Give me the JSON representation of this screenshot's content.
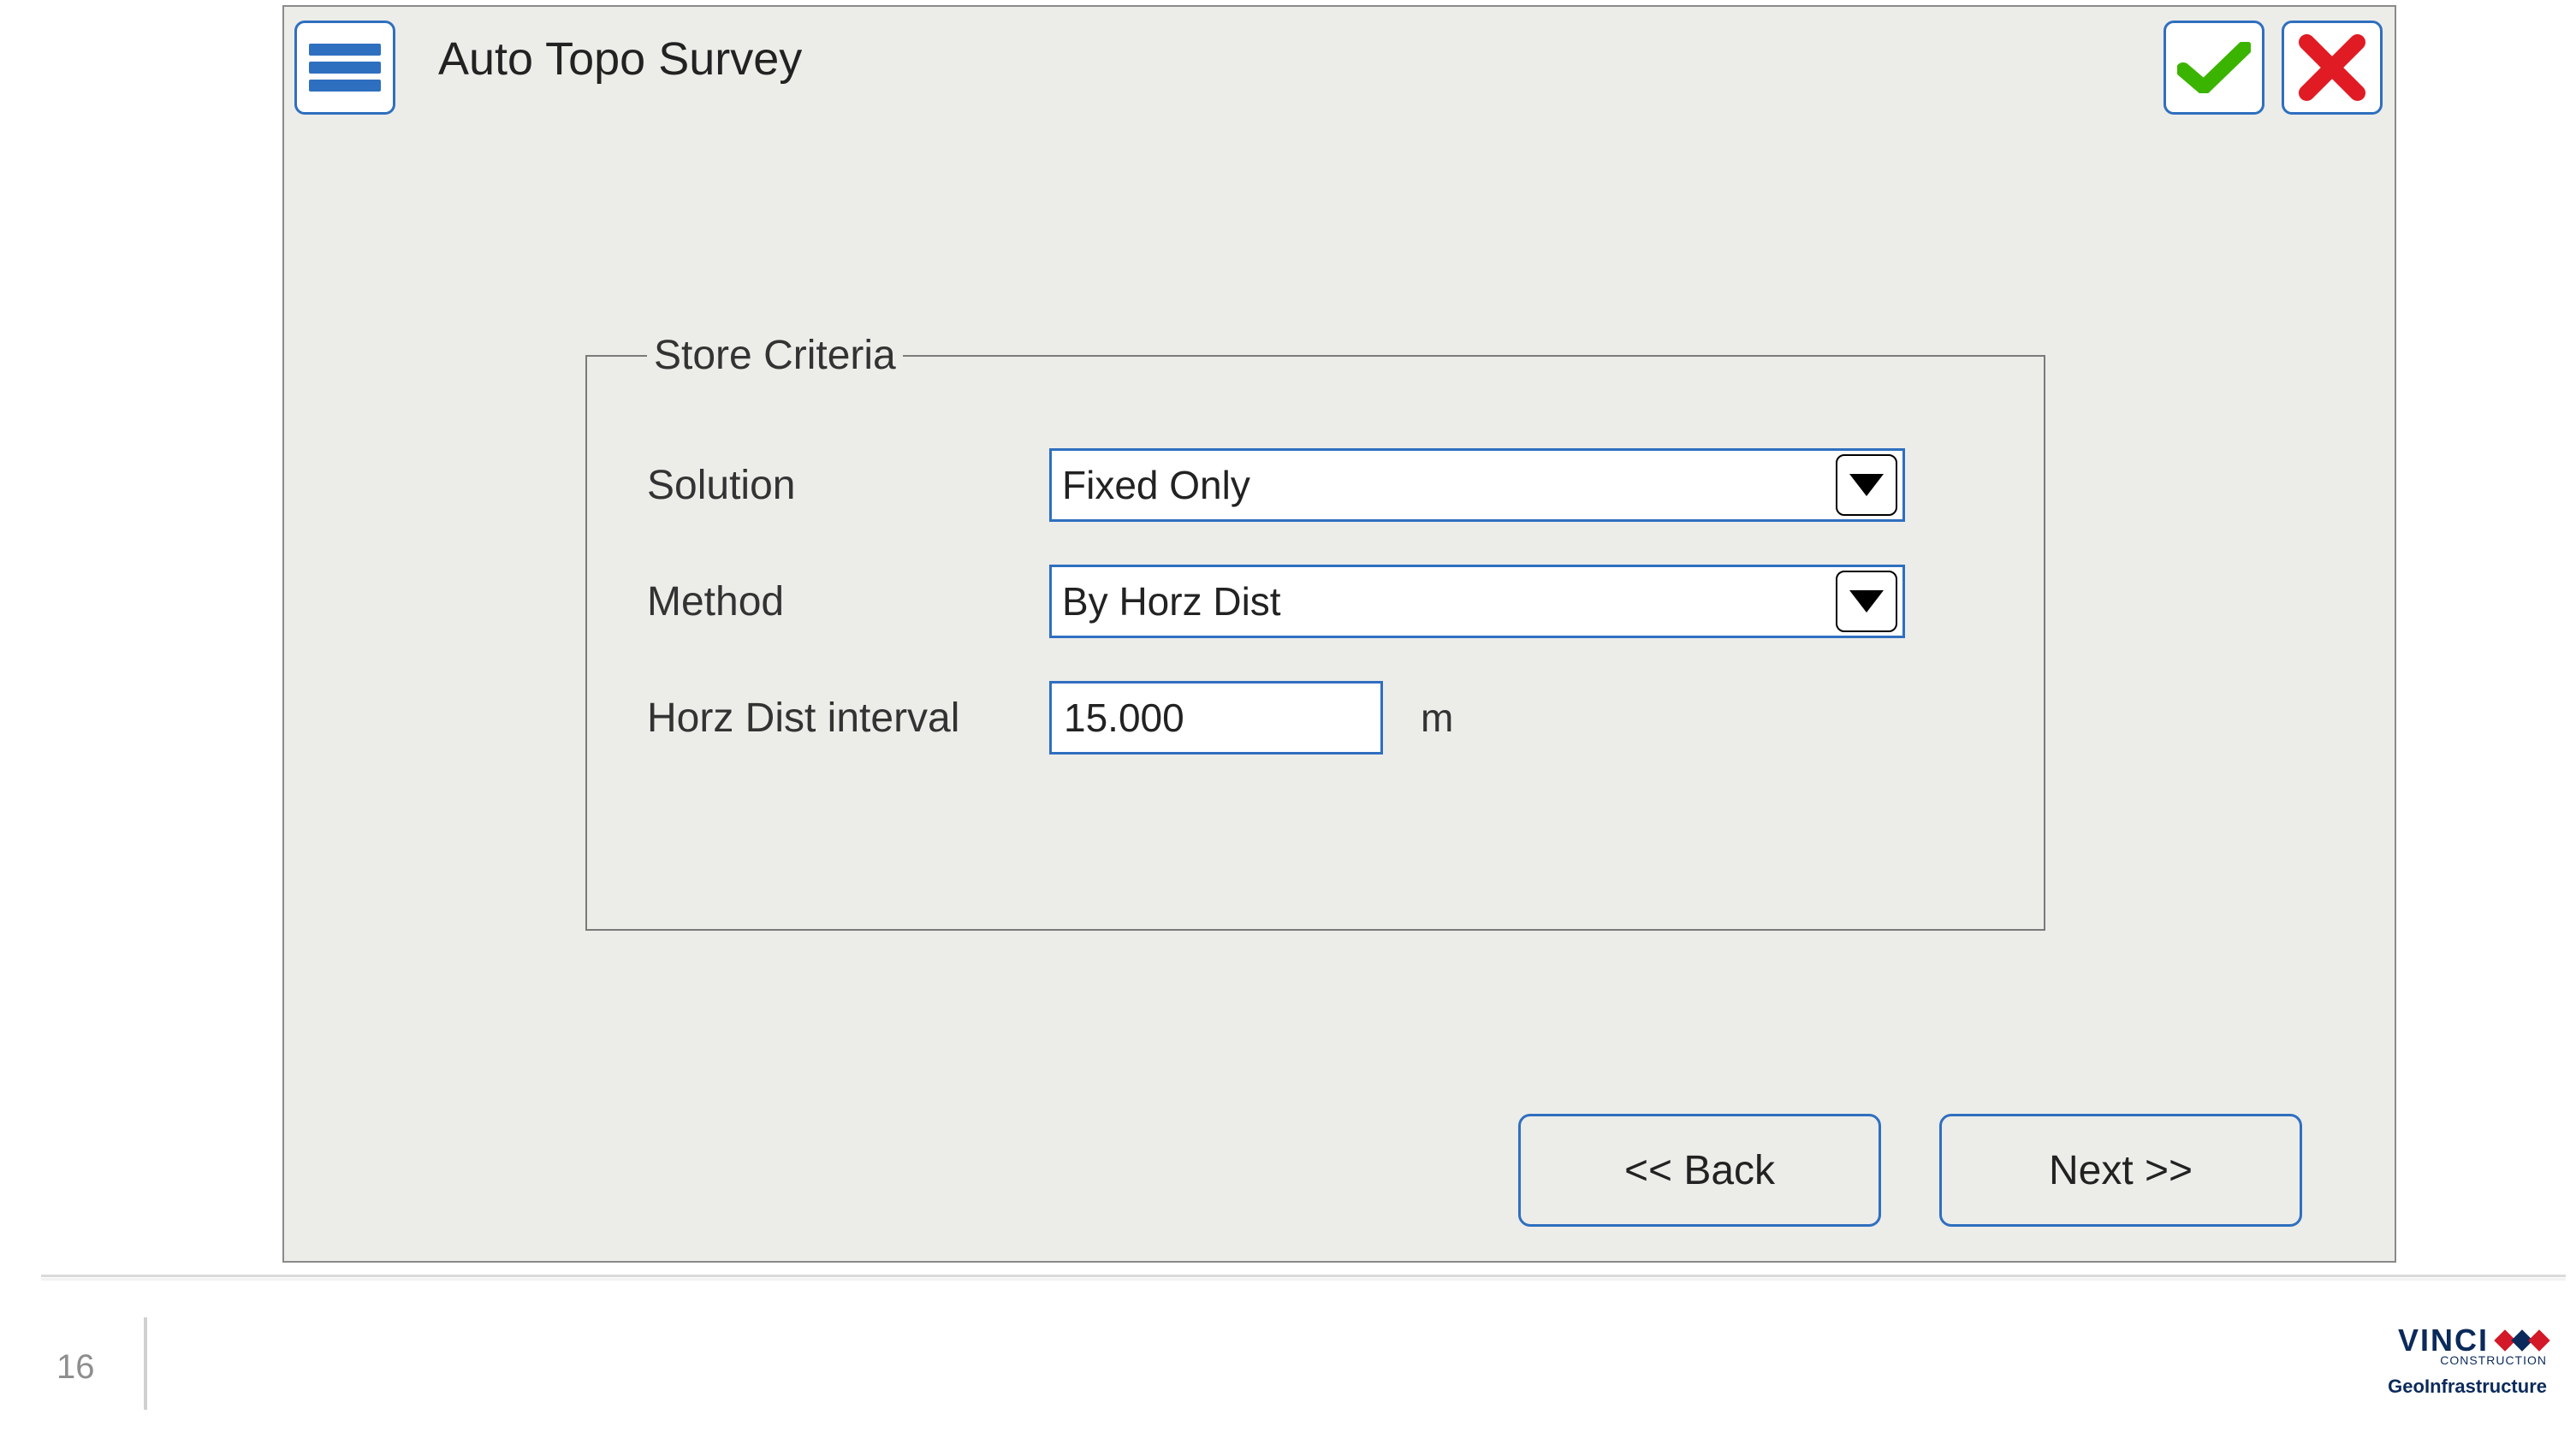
{
  "header": {
    "title": "Auto Topo Survey"
  },
  "icons": {
    "menu": "menu-icon",
    "confirm": "check-icon",
    "cancel": "x-icon",
    "dropdown": "chevron-down-icon"
  },
  "store_criteria": {
    "legend": "Store Criteria",
    "solution": {
      "label": "Solution",
      "value": "Fixed Only"
    },
    "method": {
      "label": "Method",
      "value": "By Horz Dist"
    },
    "horz_dist": {
      "label": "Horz Dist interval",
      "value": "15.000",
      "unit": "m"
    }
  },
  "nav": {
    "back": "<< Back",
    "next": "Next >>"
  },
  "footer": {
    "page_number": "16",
    "brand_name": "VINCI",
    "brand_sub1": "CONSTRUCTION",
    "brand_sub2": "GeoInfrastructure"
  },
  "colors": {
    "accent": "#2f6fbf",
    "panel_bg": "#ecece9",
    "ok_green": "#3bb400",
    "cancel_red": "#e01b24",
    "brand_blue": "#0b2a5b",
    "brand_red": "#d31828"
  }
}
